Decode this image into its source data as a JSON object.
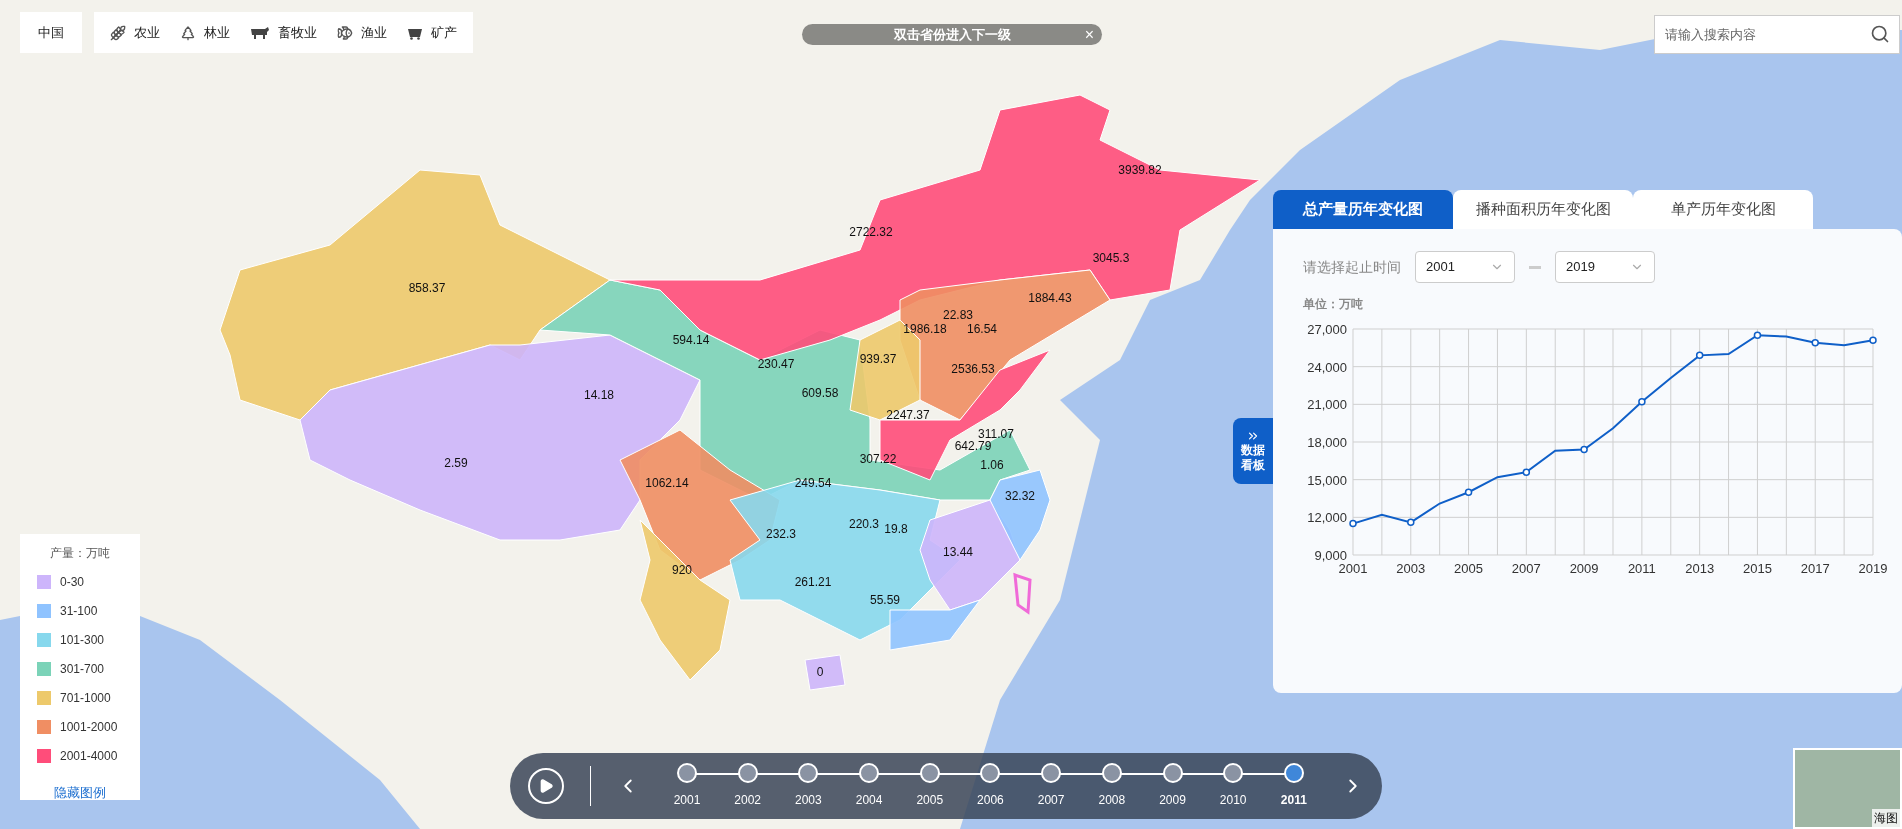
{
  "region_button": "中国",
  "categories": [
    {
      "kind": "wheat",
      "label": "农业"
    },
    {
      "kind": "tree",
      "label": "林业"
    },
    {
      "kind": "cow",
      "label": "畜牧业"
    },
    {
      "kind": "fish",
      "label": "渔业"
    },
    {
      "kind": "cart",
      "label": "矿产"
    }
  ],
  "notice": {
    "text": "双击省份进入下一级",
    "close": "×"
  },
  "search": {
    "placeholder": "请输入搜索内容"
  },
  "province_values": [
    "858.37",
    "2722.32",
    "3939.82",
    "3045.3",
    "1884.43",
    "22.83",
    "1986.18",
    "16.54",
    "594.14",
    "230.47",
    "939.37",
    "2536.53",
    "14.18",
    "609.58",
    "2247.37",
    "311.07",
    "642.79",
    "2.59",
    "307.22",
    "1.06",
    "1062.14",
    "249.54",
    "32.32",
    "232.3",
    "220.3",
    "19.8",
    "13.44",
    "920",
    "261.21",
    "55.59",
    "0"
  ],
  "legend": {
    "title": "产量：万吨",
    "hide_link": "隐藏图例",
    "items": [
      {
        "label": "0-30",
        "color": "#cdb5fb"
      },
      {
        "label": "31-100",
        "color": "#8fc3ff"
      },
      {
        "label": "101-300",
        "color": "#87d8ed"
      },
      {
        "label": "301-700",
        "color": "#7bd3b8"
      },
      {
        "label": "701-1000",
        "color": "#edc96b"
      },
      {
        "label": "1001-2000",
        "color": "#f08e63"
      },
      {
        "label": "2001-4000",
        "color": "#ff4d7a"
      }
    ]
  },
  "panel_toggle": {
    "label": "数据看板"
  },
  "panel": {
    "tabs": [
      {
        "label": "总产量历年变化图",
        "selected": true
      },
      {
        "label": "播种面积历年变化图",
        "selected": false
      },
      {
        "label": "单产历年变化图",
        "selected": false
      }
    ],
    "range_label": "请选择起止时间",
    "start": "2001",
    "end": "2019",
    "unit": "单位：万吨",
    "chart_data": {
      "type": "line",
      "x": [
        2001,
        2002,
        2003,
        2004,
        2005,
        2006,
        2007,
        2008,
        2009,
        2010,
        2011,
        2012,
        2013,
        2014,
        2015,
        2016,
        2017,
        2018,
        2019
      ],
      "grid": true,
      "series": [
        {
          "color": "#0f5fc8",
          "values": [
            11500,
            12200,
            11600,
            13100,
            14000,
            15200,
            15600,
            17300,
            17400,
            19100,
            21200,
            23100,
            24900,
            25000,
            26500,
            26400,
            25900,
            25700,
            26100
          ]
        }
      ],
      "xlim": [
        2001,
        2019
      ],
      "ylim": [
        9000,
        27000
      ],
      "xticks": [
        {
          "value": 2001,
          "label": "2001"
        },
        {
          "value": 2003,
          "label": "2003"
        },
        {
          "value": 2005,
          "label": "2005"
        },
        {
          "value": 2007,
          "label": "2007"
        },
        {
          "value": 2009,
          "label": "2009"
        },
        {
          "value": 2011,
          "label": "2011"
        },
        {
          "value": 2013,
          "label": "2013"
        },
        {
          "value": 2015,
          "label": "2015"
        },
        {
          "value": 2017,
          "label": "2017"
        },
        {
          "value": 2019,
          "label": "2019"
        }
      ],
      "yticks": [
        {
          "value": 9000,
          "label": "9,000"
        },
        {
          "value": 12000,
          "label": "12,000"
        },
        {
          "value": 15000,
          "label": "15,000"
        },
        {
          "value": 18000,
          "label": "18,000"
        },
        {
          "value": 21000,
          "label": "21,000"
        },
        {
          "value": 24000,
          "label": "24,000"
        },
        {
          "value": 27000,
          "label": "27,000"
        }
      ]
    }
  },
  "timeline": {
    "years": [
      {
        "label": "2001",
        "selected": false
      },
      {
        "label": "2002",
        "selected": false
      },
      {
        "label": "2003",
        "selected": false
      },
      {
        "label": "2004",
        "selected": false
      },
      {
        "label": "2005",
        "selected": false
      },
      {
        "label": "2006",
        "selected": false
      },
      {
        "label": "2007",
        "selected": false
      },
      {
        "label": "2008",
        "selected": false
      },
      {
        "label": "2009",
        "selected": false
      },
      {
        "label": "2010",
        "selected": false
      },
      {
        "label": "2011",
        "selected": true
      }
    ]
  },
  "minimap": {
    "label": "海图"
  }
}
